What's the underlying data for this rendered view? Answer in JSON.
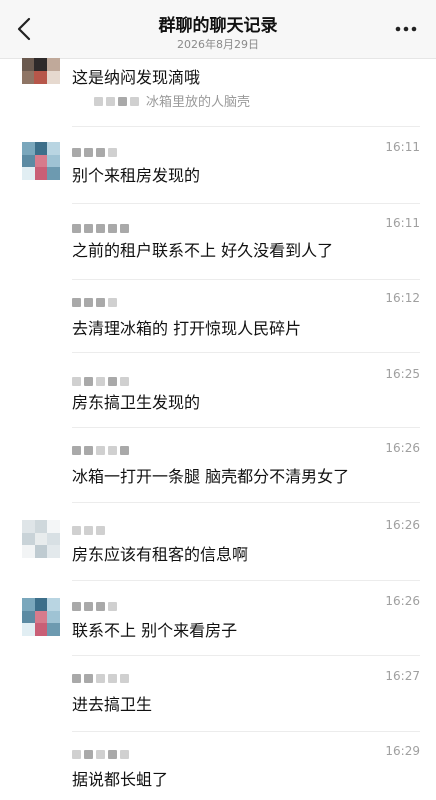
{
  "header": {
    "title": "群聊的聊天记录",
    "date": "2026年8月29日",
    "back_icon": "chevron-left-icon",
    "more_icon": "more-dots-icon"
  },
  "messages": [
    {
      "time": "",
      "text": "这是纳闷发现滴哦",
      "quote": "冰箱里放的人脑壳"
    },
    {
      "time": "16:11",
      "text": "别个来租房发现的"
    },
    {
      "time": "16:11",
      "text": "之前的租户联系不上 好久没看到人了"
    },
    {
      "time": "16:12",
      "text": "去清理冰箱的 打开惊现人民碎片"
    },
    {
      "time": "16:25",
      "text": "房东搞卫生发现的"
    },
    {
      "time": "16:26",
      "text": "冰箱一打开一条腿 脑壳都分不清男女了"
    },
    {
      "time": "16:26",
      "text": "房东应该有租客的信息啊"
    },
    {
      "time": "16:26",
      "text": "联系不上 别个来看房子"
    },
    {
      "time": "16:27",
      "text": "进去搞卫生"
    },
    {
      "time": "16:29",
      "text": "据说都长蛆了"
    }
  ]
}
